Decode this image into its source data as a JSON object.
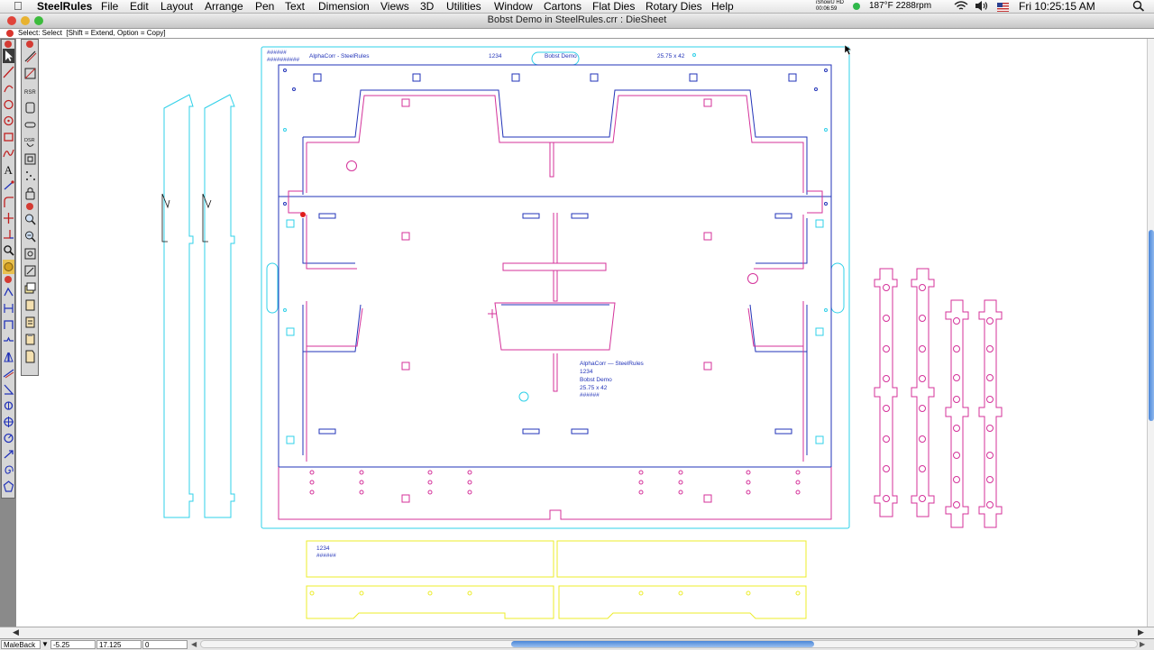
{
  "menubar": {
    "app_name": "SteelRules",
    "items": [
      "File",
      "Edit",
      "Layout",
      "Arrange",
      "Pen",
      "Text",
      "Dimension",
      "Views",
      "3D",
      "Utilities",
      "Window",
      "Cartons",
      "Flat Dies",
      "Rotary Dies",
      "Help"
    ],
    "status": {
      "ishowu_line1": "iShowU HD",
      "ishowu_line2": "00:06:59",
      "temp": "187°F 2288rpm",
      "clock": "Fri 10:25:15 AM"
    }
  },
  "window": {
    "title": "Bobst Demo in SteelRules.crr : DieSheet",
    "hint": "Select: Select  [Shift = Extend, Option = Copy]"
  },
  "sheet": {
    "header_company": "AlphaCorr  - SteelRules",
    "header_number": "1234",
    "header_name": "Bobst  Demo",
    "header_size": "25.75  x  42",
    "header_code_1": "######",
    "header_code_2": "##########"
  },
  "center_label": {
    "line1": "AlphaCorr  —  SteelRules",
    "line2": "1234",
    "line3": "Bobst  Demo",
    "line4": "25.75  x  42",
    "line5": "######"
  },
  "counter_plate": {
    "number": "1234",
    "code": "######"
  },
  "bottom": {
    "layer": "MaleBack",
    "x": "-5.25",
    "y": "17.125",
    "z": "0"
  },
  "colors": {
    "cyan": "#2fd0e8",
    "magenta": "#d4329a",
    "blue": "#2233b8",
    "yellow": "#ecec2a",
    "scroll_accent": "#4a86d8"
  },
  "icons": {
    "apple": "apple-icon",
    "spotlight": "search-icon",
    "wifi": "wifi-icon",
    "volume": "volume-icon",
    "flag": "us-flag-icon"
  }
}
